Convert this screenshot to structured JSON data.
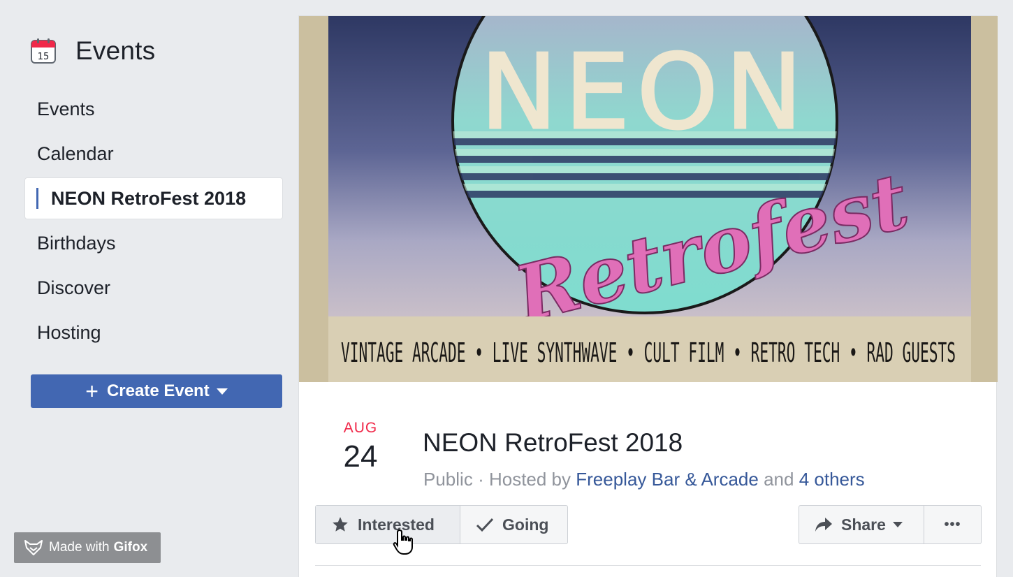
{
  "sidebar": {
    "title": "Events",
    "calendar_icon_day": "15",
    "items": [
      {
        "label": "Events"
      },
      {
        "label": "Calendar"
      },
      {
        "label": "NEON RetroFest 2018"
      },
      {
        "label": "Birthdays"
      },
      {
        "label": "Discover"
      },
      {
        "label": "Hosting"
      }
    ],
    "create_button": "Create Event"
  },
  "watermark": {
    "prefix": "Made with",
    "brand": "Gifox"
  },
  "cover": {
    "logo_text": "NEON",
    "script_text": "Retrofest",
    "tagline": "VINTAGE ARCADE • LIVE SYNTHWAVE • CULT FILM • RETRO TECH • RAD GUESTS"
  },
  "event": {
    "month": "AUG",
    "day": "24",
    "title": "NEON RetroFest 2018",
    "privacy": "Public",
    "hosted_by": "Hosted by",
    "host": "Freeplay Bar & Arcade",
    "and": "and",
    "others": "4 others"
  },
  "actions": {
    "interested": "Interested",
    "going": "Going",
    "share": "Share",
    "more": "•••"
  },
  "colors": {
    "accent": "#4267b2",
    "link": "#365899",
    "date_month": "#f02849"
  }
}
